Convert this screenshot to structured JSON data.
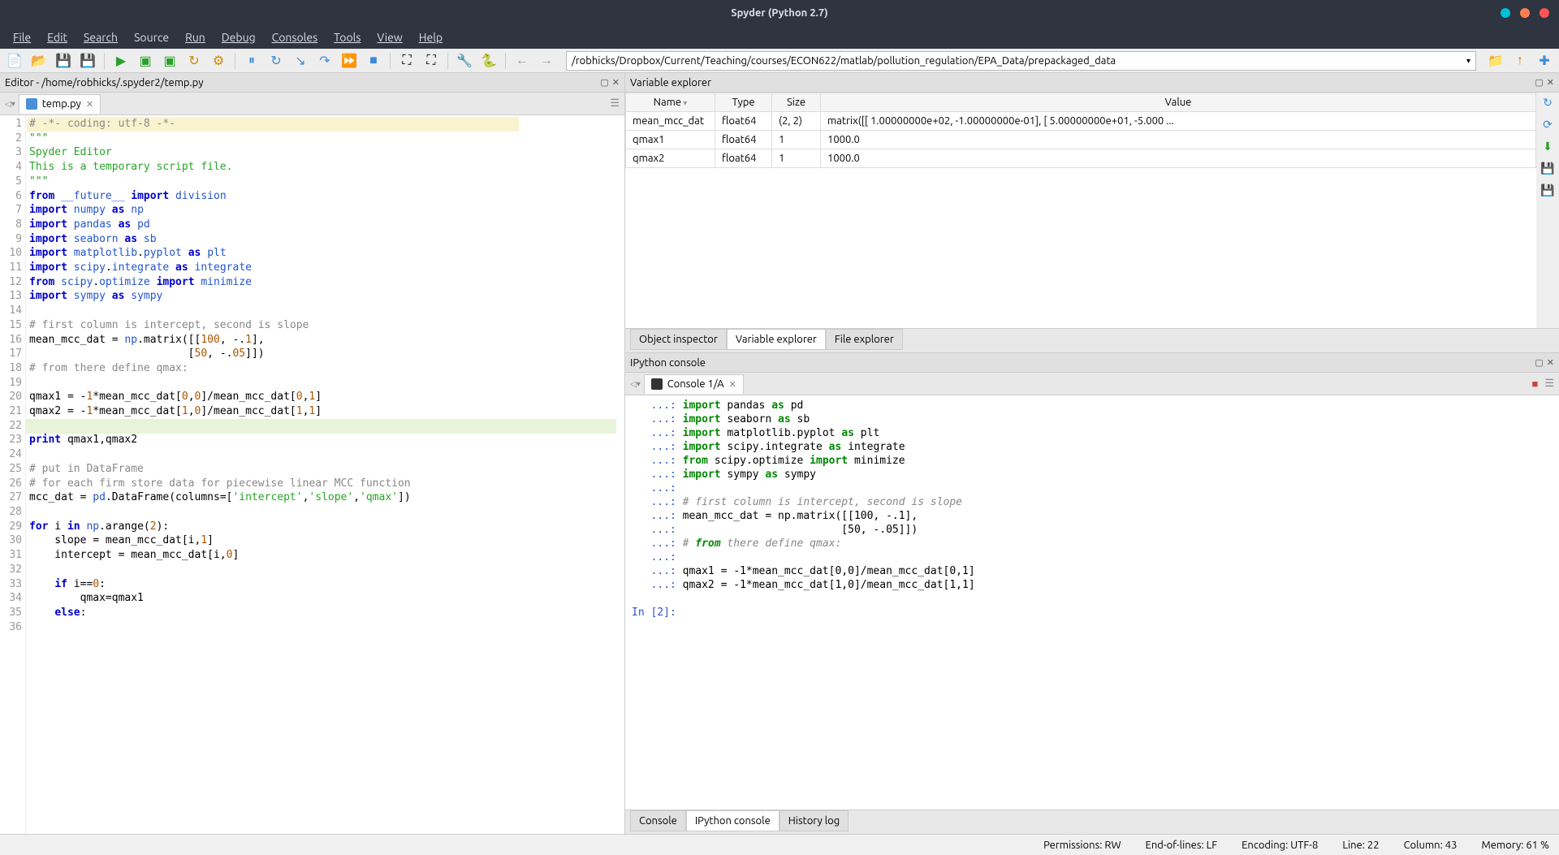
{
  "window": {
    "title": "Spyder (Python 2.7)"
  },
  "menu": {
    "file": "File",
    "edit": "Edit",
    "search": "Search",
    "source": "Source",
    "run": "Run",
    "debug": "Debug",
    "consoles": "Consoles",
    "tools": "Tools",
    "view": "View",
    "help": "Help"
  },
  "path": "/robhicks/Dropbox/Current/Teaching/courses/ECON622/matlab/pollution_regulation/EPA_Data/prepackaged_data",
  "editor": {
    "title": "Editor - /home/robhicks/.spyder2/temp.py",
    "tab": "temp.py",
    "lines": [
      "# -*- coding: utf-8 -*-",
      "\"\"\"",
      "Spyder Editor",
      "",
      "This is a temporary script file.",
      "\"\"\"",
      "from __future__ import division",
      "import numpy as np",
      "import pandas as pd",
      "import seaborn as sb",
      "import matplotlib.pyplot as plt",
      "import scipy.integrate as integrate",
      "from scipy.optimize import minimize",
      "import sympy as sympy",
      "",
      "# first column is intercept, second is slope",
      "mean_mcc_dat = np.matrix([[100, -.1],",
      "                         [50, -.05]])",
      "# from there define qmax:",
      "",
      "qmax1 = -1*mean_mcc_dat[0,0]/mean_mcc_dat[0,1]",
      "qmax2 = -1*mean_mcc_dat[1,0]/mean_mcc_dat[1,1]",
      "",
      "print qmax1,qmax2",
      "",
      "# put in DataFrame",
      "# for each firm store data for piecewise linear MCC function",
      "mcc_dat = pd.DataFrame(columns=['intercept','slope','qmax'])",
      "",
      "for i in np.arange(2):",
      "    slope = mean_mcc_dat[i,1]",
      "    intercept = mean_mcc_dat[i,0]",
      "",
      "    if i==0:",
      "        qmax=qmax1",
      "    else:"
    ]
  },
  "varexp": {
    "title": "Variable explorer",
    "cols": {
      "name": "Name",
      "type": "Type",
      "size": "Size",
      "value": "Value"
    },
    "rows": [
      {
        "name": "mean_mcc_dat",
        "type": "float64",
        "size": "(2, 2)",
        "value": "matrix([[  1.00000000e+02,  -1.00000000e-01],\n        [  5.00000000e+01,  -5.000 ..."
      },
      {
        "name": "qmax1",
        "type": "float64",
        "size": "1",
        "value": "1000.0"
      },
      {
        "name": "qmax2",
        "type": "float64",
        "size": "1",
        "value": "1000.0"
      }
    ],
    "tabs": {
      "obj": "Object inspector",
      "var": "Variable explorer",
      "file": "File explorer"
    }
  },
  "console": {
    "title": "IPython console",
    "tab": "Console 1/A",
    "tabs": {
      "console": "Console",
      "ipython": "IPython console",
      "history": "History log"
    },
    "lines": [
      "   ...: import pandas as pd",
      "   ...: import seaborn as sb",
      "   ...: import matplotlib.pyplot as plt",
      "   ...: import scipy.integrate as integrate",
      "   ...: from scipy.optimize import minimize",
      "   ...: import sympy as sympy",
      "   ...: ",
      "   ...: # first column is intercept, second is slope",
      "   ...: mean_mcc_dat = np.matrix([[100, -.1],",
      "   ...:                          [50, -.05]])",
      "   ...: # from there define qmax:",
      "   ...: ",
      "   ...: qmax1 = -1*mean_mcc_dat[0,0]/mean_mcc_dat[0,1]",
      "   ...: qmax2 = -1*mean_mcc_dat[1,0]/mean_mcc_dat[1,1]",
      "",
      "In [2]: "
    ]
  },
  "status": {
    "perm": "Permissions: RW",
    "eol": "End-of-lines: LF",
    "enc": "Encoding: UTF-8",
    "line": "Line: 22",
    "col": "Column: 43",
    "mem": "Memory: 61 %"
  }
}
